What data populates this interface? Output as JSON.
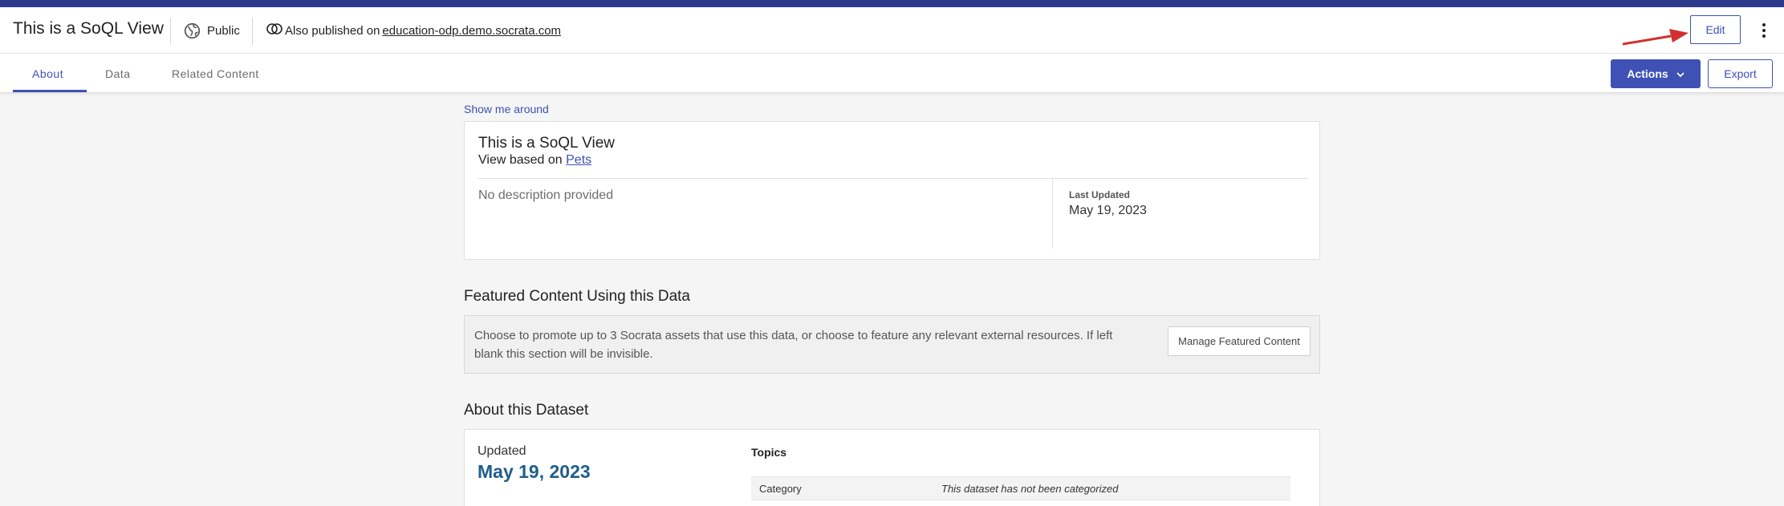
{
  "header": {
    "title": "This is a SoQL View",
    "visibility": "Public",
    "published_prefix": "Also published on",
    "published_domain": "education-odp.demo.socrata.com",
    "edit_label": "Edit",
    "icons": {
      "visibility": "globe-icon",
      "published": "federation-icon",
      "menu": "more-vertical-icon",
      "annotation": "red-arrow-icon"
    }
  },
  "tabs": [
    {
      "label": "About",
      "active": true
    },
    {
      "label": "Data",
      "active": false
    },
    {
      "label": "Related Content",
      "active": false
    }
  ],
  "toolbar": {
    "actions_label": "Actions",
    "export_label": "Export"
  },
  "main": {
    "show_me_around": "Show me around",
    "info_card": {
      "title": "This is a SoQL View",
      "based_on_prefix": "View based on",
      "based_on_link": "Pets",
      "description": "No description provided",
      "last_updated_label": "Last Updated",
      "last_updated_value": "May 19, 2023"
    },
    "featured": {
      "title": "Featured Content Using this Data",
      "text": "Choose to promote up to 3 Socrata assets that use this data, or choose to feature any relevant external resources. If left blank this section will be invisible.",
      "button_label": "Manage Featured Content"
    },
    "about": {
      "title": "About this Dataset",
      "updated_label": "Updated",
      "updated_value": "May 19, 2023",
      "topics_label": "Topics",
      "category_label": "Category",
      "category_value": "This dataset has not been categorized"
    }
  },
  "colors": {
    "brand": "#3f51b5",
    "top_bar": "#2e3a8c",
    "accent_date": "#1f5e8c",
    "annotation": "#d32f2f"
  }
}
